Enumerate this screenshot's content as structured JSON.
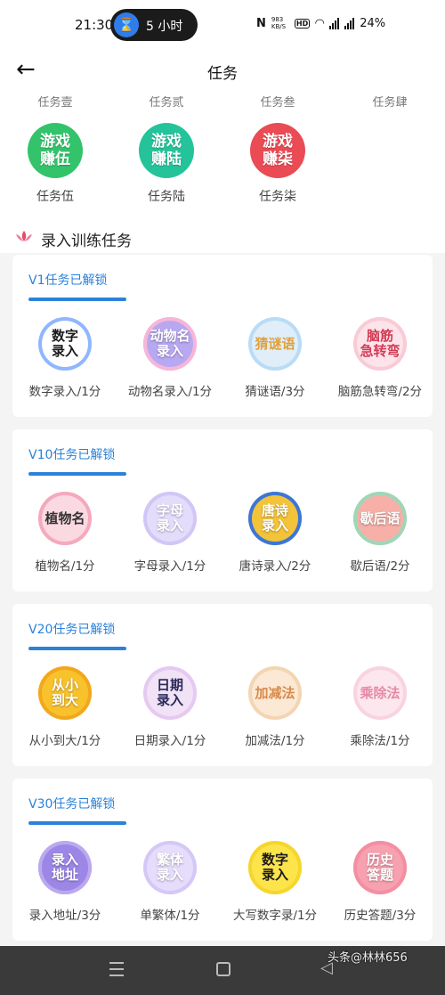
{
  "status_bar": {
    "time": "21:30",
    "pill_text": "5 小时",
    "speed": "983 KB/S",
    "hd": "HD",
    "network_1": "4G",
    "network_2": "4G",
    "battery": "24%"
  },
  "header": {
    "title": "任务"
  },
  "top_section": {
    "cut_labels": [
      "任务壹",
      "任务贰",
      "任务叁",
      "任务肆"
    ],
    "games": [
      {
        "icon_text": "游戏\n赚伍",
        "label": "任务伍",
        "color": "#33c36b"
      },
      {
        "icon_text": "游戏\n赚陆",
        "label": "任务陆",
        "color": "#25c39a"
      },
      {
        "icon_text": "游戏\n赚柒",
        "label": "任务柒",
        "color": "#ea4b55"
      }
    ]
  },
  "section": {
    "title": "录入训练任务"
  },
  "cards": [
    {
      "title": "V1任务已解锁",
      "tasks": [
        {
          "icon_text": "数字\n录入",
          "label": "数字录入/1分",
          "bg": "#ffffff",
          "fg": "#1a1a1a",
          "ring": "#8fb6ff"
        },
        {
          "icon_text": "动物名\n录入",
          "label": "动物名录入/1分",
          "bg": "#b8a8f2",
          "fg": "#ffffff",
          "ring": "#f7b6d7"
        },
        {
          "icon_text": "猜谜语",
          "label": "猜谜语/3分",
          "bg": "#dfeef9",
          "fg": "#e0a13a",
          "ring": "#b9dcf6"
        },
        {
          "icon_text": "脑筋\n急转弯",
          "label": "脑筋急转弯/2分",
          "bg": "#fde4ea",
          "fg": "#d23b55",
          "ring": "#f9cbd6"
        }
      ]
    },
    {
      "title": "V10任务已解锁",
      "tasks": [
        {
          "icon_text": "植物名",
          "label": "植物名/1分",
          "bg": "#fbd9e2",
          "fg": "#333333",
          "ring": "#f5a9bd"
        },
        {
          "icon_text": "字母\n录入",
          "label": "字母录入/1分",
          "bg": "#e4dcfb",
          "fg": "#ffffff",
          "ring": "#d2c6f7"
        },
        {
          "icon_text": "唐诗\n录入",
          "label": "唐诗录入/2分",
          "bg": "#f3c33a",
          "fg": "#ffffff",
          "ring": "#3a77d8"
        },
        {
          "icon_text": "歇后语",
          "label": "歇后语/2分",
          "bg": "#f6b0a8",
          "fg": "#ffffff",
          "ring": "#9ed7b8"
        }
      ]
    },
    {
      "title": "V20任务已解锁",
      "tasks": [
        {
          "icon_text": "从小\n到大",
          "label": "从小到大/1分",
          "bg": "#f8c22d",
          "fg": "#ffffff",
          "ring": "#f3a71c"
        },
        {
          "icon_text": "日期\n录入",
          "label": "日期录入/1分",
          "bg": "#f1e2f6",
          "fg": "#2a2a5a",
          "ring": "#e6c9f2"
        },
        {
          "icon_text": "加减法",
          "label": "加减法/1分",
          "bg": "#fbe9d5",
          "fg": "#d88a4a",
          "ring": "#f4d5b3"
        },
        {
          "icon_text": "乘除法",
          "label": "乘除法/1分",
          "bg": "#fde7ee",
          "fg": "#e58aa6",
          "ring": "#f9d3df"
        }
      ]
    },
    {
      "title": "V30任务已解锁",
      "tasks": [
        {
          "icon_text": "录入\n地址",
          "label": "录入地址/3分",
          "bg": "#9c86e6",
          "fg": "#ffffff",
          "ring": "#bba9f0"
        },
        {
          "icon_text": "繁体\n录入",
          "label": "单繁体/1分",
          "bg": "#e5ddfb",
          "fg": "#ffffff",
          "ring": "#d4c8f8"
        },
        {
          "icon_text": "数字\n录入",
          "label": "大写数字录/1分",
          "bg": "#fde44a",
          "fg": "#1a1a1a",
          "ring": "#f6d62c"
        },
        {
          "icon_text": "历史\n答题",
          "label": "历史答题/3分",
          "bg": "#f7a1b0",
          "fg": "#ffffff",
          "ring": "#f48ea1"
        }
      ]
    }
  ],
  "watermark": "头条@林林656"
}
